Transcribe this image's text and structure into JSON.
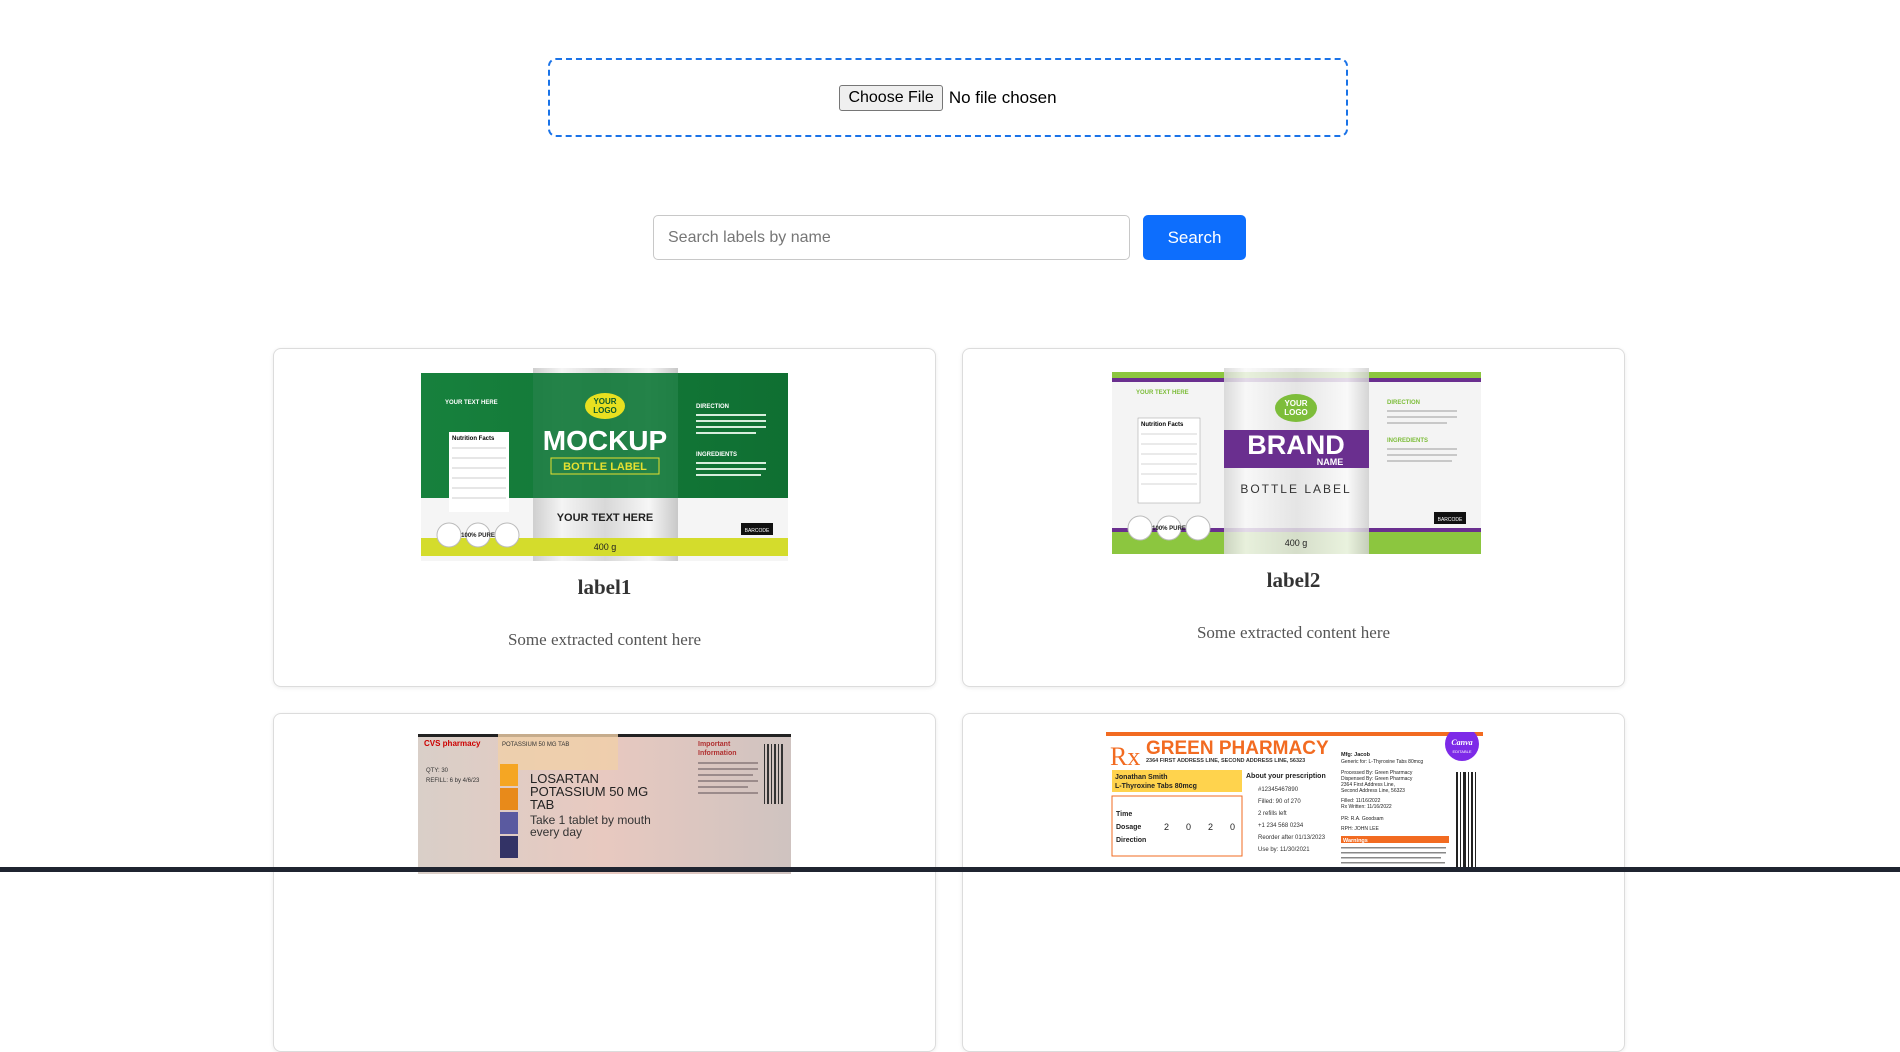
{
  "upload": {
    "button_label": "Choose File",
    "status_text": "No file chosen"
  },
  "search": {
    "placeholder": "Search labels by name",
    "button_label": "Search"
  },
  "cards": [
    {
      "title": "label1",
      "description": "Some extracted content here",
      "image": {
        "logo_line1": "YOUR",
        "logo_line2": "LOGO",
        "headline": "MOCKUP",
        "subheadline": "BOTTLE LABEL",
        "text_here": "YOUR TEXT HERE",
        "left_heading": "YOUR TEXT HERE",
        "nutrition": "Nutrition Facts",
        "direction": "DIRECTION",
        "ingredients": "INGREDIENTS",
        "weight": "400 g",
        "barcode": "BARCODE",
        "badge1": "YOUR TEXT HERE",
        "badge2": "100% PURE",
        "badge3": "MADE COUNTRY"
      }
    },
    {
      "title": "label2",
      "description": "Some extracted content here",
      "image": {
        "logo_line1": "YOUR",
        "logo_line2": "LOGO",
        "headline": "BRAND",
        "subheadline": "NAME",
        "text_here": "BOTTLE LABEL",
        "left_heading": "YOUR TEXT HERE",
        "nutrition": "Nutrition Facts",
        "direction": "DIRECTION",
        "ingredients": "INGREDIENTS",
        "weight": "400 g",
        "barcode": "BARCODE",
        "badge1": "YOUR TEXT HERE",
        "badge2": "100% PURE",
        "badge3": "MADE COUNTRY"
      }
    },
    {
      "image": {
        "pharmacy": "CVS pharmacy",
        "drug_header": "POTASSIUM 50 MG TAB",
        "qty": "QTY: 30",
        "refill": "REFILL: 6 by 4/6/23",
        "drug_line1": "LOSARTAN",
        "drug_line2": "POTASSIUM 50 MG",
        "drug_line3": "TAB",
        "instruction1": "Take 1 tablet by mouth",
        "instruction2": "every day",
        "important": "Important",
        "information": "Information"
      }
    },
    {
      "image": {
        "rx": "Rx",
        "pharmacy_name": "GREEN PHARMACY",
        "address": "2364 FIRST ADDRESS LINE, SECOND ADDRESS LINE, 56323",
        "patient": "Jonathan Smith",
        "drug": "L-Thyroxine Tabs 80mcg",
        "about": "About your prescription",
        "time": "Time",
        "dosage": "Dosage",
        "direction": "Direction",
        "dosage_values": [
          "2",
          "0",
          "2",
          "0"
        ],
        "rx_number": "#12345467890",
        "filled": "Filled: 90 of 270",
        "refills": "2 refills left",
        "phone": "+1 234 568 0234",
        "reorder": "Reorder after 01/13/2023",
        "use_by": "Use by: 11/30/2021",
        "direction_text": "Take tablets with food to treat irregular metabolism.",
        "mfg": "Mfg: Jacob",
        "generic": "Generic for: L-Thyroxine Tabs 80mcg",
        "processed": "Processed By: Green Pharmacy",
        "dispensed": "Dispensed By: Green Pharmacy",
        "addr1": "2364 First Address Line,",
        "addr2": "Second Address Line, 56323",
        "filled_date": "Filled: 11/16/2022",
        "written": "Rx Written: 11/16/2022",
        "pr": "PR: R.A. Goodsam",
        "rph": "RPH: JOHN LEE",
        "warnings": "Warnings",
        "warning_text": "Warnings: Do not drink alcoholic beverages when taking medication. Do not use while you are breastfeeding. Keep away from children. Federal Law prohibits transfer of this drug to any person other than the patient for whom prescribed.",
        "canva": "Canva",
        "editable": "EDITABLE"
      }
    }
  ]
}
